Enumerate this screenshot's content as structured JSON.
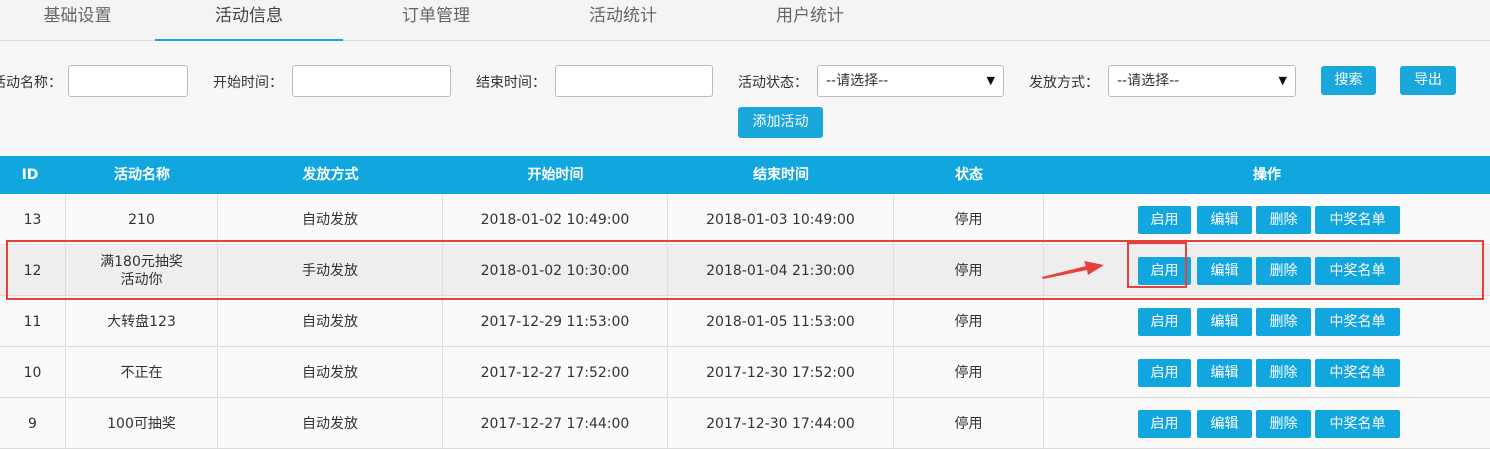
{
  "tabs": [
    {
      "label": "基础设置"
    },
    {
      "label": "活动信息"
    },
    {
      "label": "订单管理"
    },
    {
      "label": "活动统计"
    },
    {
      "label": "用户统计"
    }
  ],
  "filters": {
    "name_label": "活动名称：",
    "start_label": "开始时间：",
    "end_label": "结束时间：",
    "status_label": "活动状态：",
    "status_value": "--请选择--",
    "method_label": "发放方式：",
    "method_value": "--请选择--",
    "search_label": "搜索",
    "export_label": "导出",
    "add_label": "添加活动"
  },
  "table": {
    "columns": [
      "ID",
      "活动名称",
      "发放方式",
      "开始时间",
      "结束时间",
      "状态",
      "操作"
    ],
    "actions": [
      "启用",
      "编辑",
      "删除",
      "中奖名单"
    ],
    "rows": [
      {
        "id": "13",
        "name": "210",
        "method": "自动发放",
        "start": "2018-01-02 10:49:00",
        "end": "2018-01-03 10:49:00",
        "status": "停用"
      },
      {
        "id": "12",
        "name": "满180元抽奖活动你",
        "method": "手动发放",
        "start": "2018-01-02 10:30:00",
        "end": "2018-01-04 21:30:00",
        "status": "停用"
      },
      {
        "id": "11",
        "name": "大转盘123",
        "method": "自动发放",
        "start": "2017-12-29 11:53:00",
        "end": "2018-01-05 11:53:00",
        "status": "停用"
      },
      {
        "id": "10",
        "name": "不正在",
        "method": "自动发放",
        "start": "2017-12-27 17:52:00",
        "end": "2017-12-30 17:52:00",
        "status": "停用"
      },
      {
        "id": "9",
        "name": "100可抽奖",
        "method": "自动发放",
        "start": "2017-12-27 17:44:00",
        "end": "2017-12-30 17:44:00",
        "status": "停用"
      }
    ]
  },
  "colors": {
    "accent": "#12a6df",
    "highlight": "#e8403d"
  }
}
